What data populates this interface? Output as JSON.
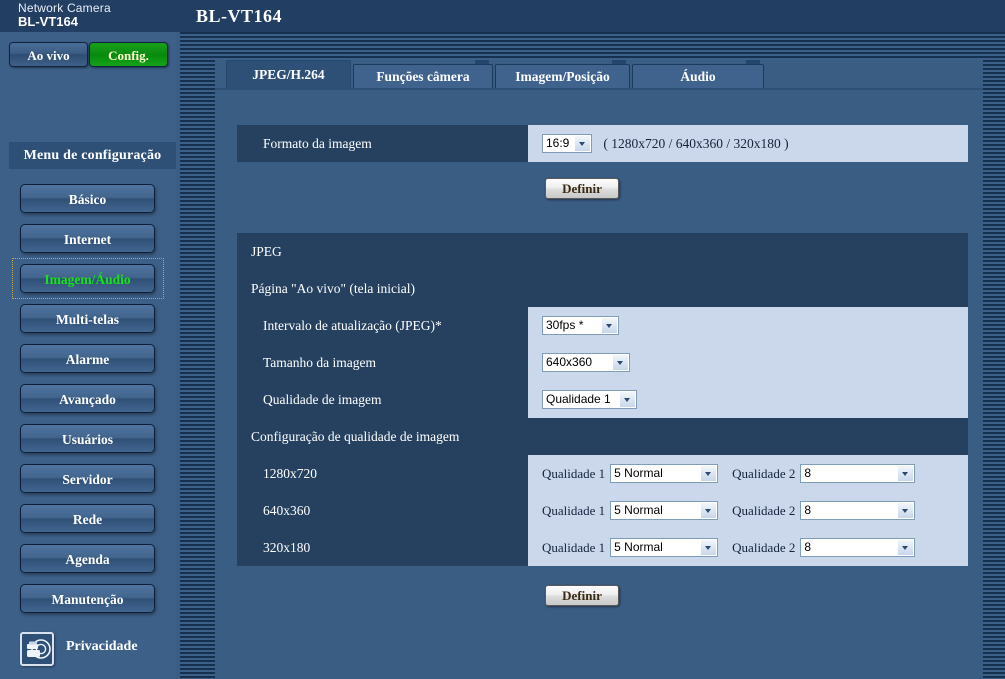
{
  "header": {
    "product_kind": "Network Camera",
    "model": "BL-VT164",
    "title": "BL-VT164"
  },
  "topnav": {
    "live_label": "Ao vivo",
    "config_label": "Config."
  },
  "sidebar": {
    "menu_title": "Menu de configuração",
    "items": [
      {
        "label": "Básico",
        "name": "basico",
        "active": false
      },
      {
        "label": "Internet",
        "name": "internet",
        "active": false
      },
      {
        "label": "Imagem/Áudio",
        "name": "imagem-audio",
        "active": true
      },
      {
        "label": "Multi-telas",
        "name": "multi-telas",
        "active": false
      },
      {
        "label": "Alarme",
        "name": "alarme",
        "active": false
      },
      {
        "label": "Avançado",
        "name": "avancado",
        "active": false
      },
      {
        "label": "Usuários",
        "name": "usuarios",
        "active": false
      },
      {
        "label": "Servidor",
        "name": "servidor",
        "active": false
      },
      {
        "label": "Rede",
        "name": "rede",
        "active": false
      },
      {
        "label": "Agenda",
        "name": "agenda",
        "active": false
      },
      {
        "label": "Manutenção",
        "name": "manutencao",
        "active": false
      }
    ],
    "privacy_label": "Privacidade",
    "privacy_icon": "privacy-hand-icon"
  },
  "tabs": [
    {
      "label": "JPEG/H.264",
      "selected": true
    },
    {
      "label": "Funções câmera",
      "selected": false
    },
    {
      "label": "Imagem/Posição",
      "selected": false
    },
    {
      "label": "Áudio",
      "selected": false
    }
  ],
  "format_section": {
    "label": "Formato da imagem",
    "value": "16:9",
    "note": "( 1280x720 / 640x360 / 320x180 )",
    "submit_label": "Definir"
  },
  "jpeg_section": {
    "heading": "JPEG",
    "subheading": "Página \"Ao vivo\" (tela inicial)",
    "refresh_interval": {
      "label": "Intervalo de atualização (JPEG)*",
      "value": "30fps *"
    },
    "image_size": {
      "label": "Tamanho da imagem",
      "value": "640x360"
    },
    "image_quality": {
      "label": "Qualidade de imagem",
      "value": "Qualidade 1"
    },
    "quality_config_heading": "Configuração de qualidade de imagem",
    "quality_rows": [
      {
        "resolution": "1280x720",
        "q1_label": "Qualidade 1",
        "q1_value": "5 Normal",
        "q2_label": "Qualidade 2",
        "q2_value": "8"
      },
      {
        "resolution": "640x360",
        "q1_label": "Qualidade 1",
        "q1_value": "5 Normal",
        "q2_label": "Qualidade 2",
        "q2_value": "8"
      },
      {
        "resolution": "320x180",
        "q1_label": "Qualidade 1",
        "q1_value": "5 Normal",
        "q2_label": "Qualidade 2",
        "q2_value": "8"
      }
    ],
    "submit_label": "Definir"
  },
  "colors": {
    "page_bg": "#3a5d84",
    "header_bg": "#223e63",
    "label_cell": "#25415f",
    "value_cell": "#cbd8ec",
    "active_menu_text": "#17e217",
    "config_button": "#0d8d12"
  }
}
